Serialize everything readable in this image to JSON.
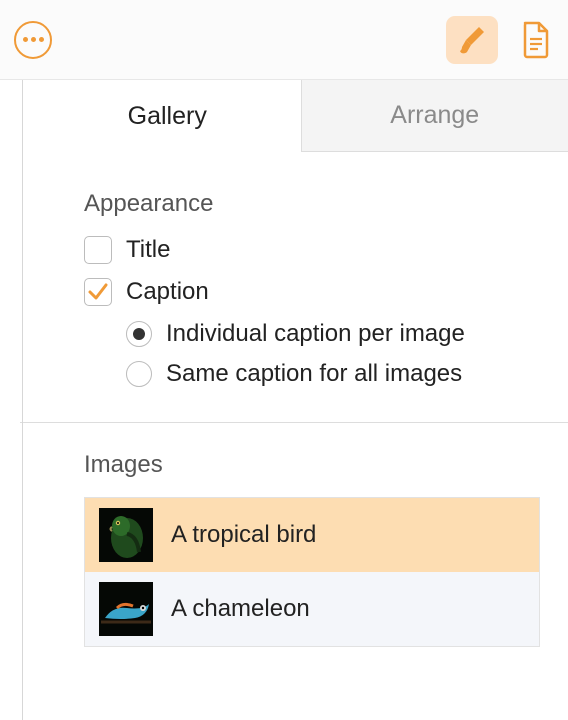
{
  "tabs": {
    "gallery": "Gallery",
    "arrange": "Arrange"
  },
  "appearance": {
    "heading": "Appearance",
    "title_label": "Title",
    "title_checked": false,
    "caption_label": "Caption",
    "caption_checked": true,
    "radio_individual": "Individual caption per image",
    "radio_same": "Same caption for all images"
  },
  "images": {
    "heading": "Images",
    "items": [
      {
        "caption": "A tropical bird"
      },
      {
        "caption": "A chameleon"
      }
    ]
  },
  "colors": {
    "accent": "#f09a37",
    "accent_light": "#fde0c2",
    "selection": "#fdddb2"
  }
}
